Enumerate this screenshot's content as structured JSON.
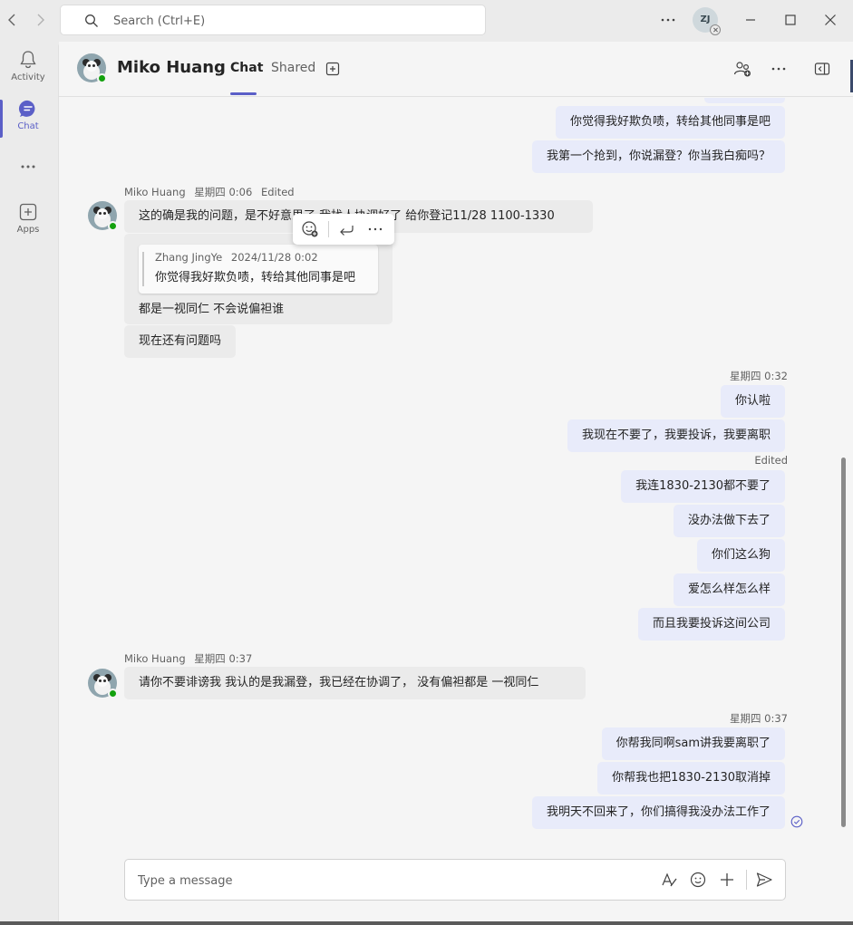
{
  "search": {
    "placeholder": "Search (Ctrl+E)"
  },
  "user": {
    "initials": "ZJ"
  },
  "rail": [
    {
      "label": "Activity"
    },
    {
      "label": "Chat"
    },
    {
      "label": "Apps"
    }
  ],
  "header": {
    "chat_name": "Miko Huang",
    "tabs": [
      {
        "label": "Chat"
      },
      {
        "label": "Shared"
      }
    ]
  },
  "messages": {
    "out_top_1": "你觉得我好欺负啧，转给其他同事是吧",
    "out_top_2": "我第一个抢到，你说漏登？你当我白痴吗？",
    "group1": {
      "sender": "Miko Huang",
      "time": "星期四 0:06",
      "edited": "Edited",
      "msg1": "这的确是我的问题，是不好意思了  我找人协调好了  给你登记11/28 1100-1330",
      "quote": {
        "author": "Zhang JingYe",
        "time": "2024/11/28 0:02",
        "text": "你觉得我好欺负啧，转给其他同事是吧"
      },
      "reply": "都是一视同仁 不会说偏袒谁",
      "msg3": "现在还有问题吗"
    },
    "out_group2": {
      "time": "星期四 0:32",
      "msgs": [
        "你认啦",
        "我现在不要了，我要投诉，我要离职"
      ],
      "edited": "Edited",
      "msgs2": [
        "我连1830-2130都不要了",
        "没办法做下去了",
        "你们这么狗",
        "爱怎么样怎么样",
        "而且我要投诉这间公司"
      ]
    },
    "group3": {
      "sender": "Miko Huang",
      "time": "星期四 0:37",
      "msg": "请你不要诽谤我  我认的是我漏登，我已经在协调了， 没有偏袒都是 一视同仁"
    },
    "out_group4": {
      "time": "星期四 0:37",
      "msgs": [
        "你帮我同啊sam讲我要离职了",
        "你帮我也把1830-2130取消掉",
        "我明天不回来了，你们搞得我没办法工作了"
      ]
    }
  },
  "compose": {
    "placeholder": "Type a message"
  },
  "colors": {
    "accent": "#5b5fc7",
    "outgoing_bubble": "#e8ebfa",
    "incoming_bubble": "#ebebeb",
    "presence_available": "#13a10e"
  }
}
